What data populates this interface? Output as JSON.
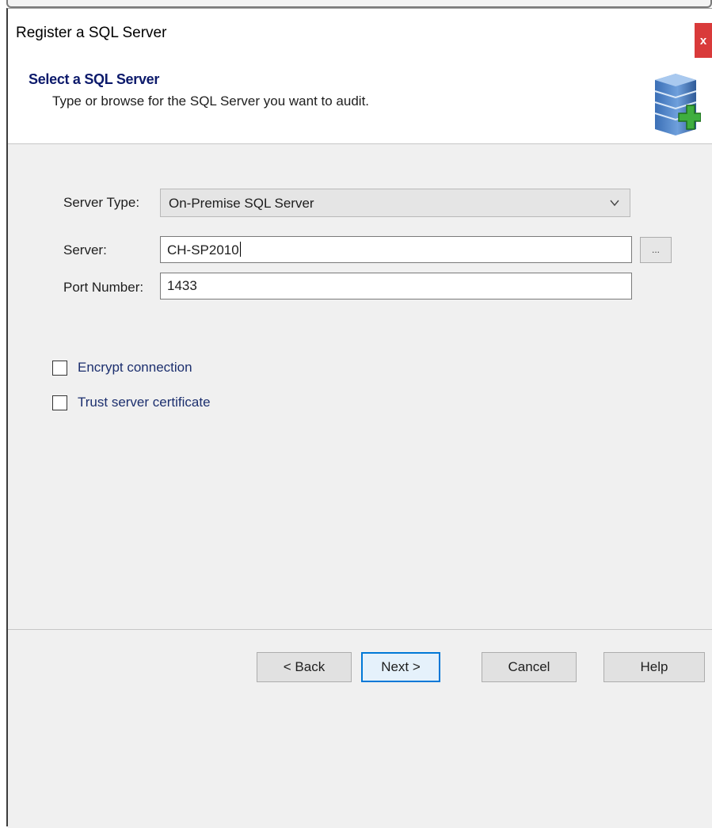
{
  "window": {
    "title": "Register a SQL Server",
    "close_label": "x"
  },
  "header": {
    "title": "Select a SQL Server",
    "subtitle": "Type or browse for the SQL Server you want to audit.",
    "icon": "database-server-add-icon"
  },
  "form": {
    "server_type_label": "Server Type:",
    "server_type_value": "On-Premise SQL Server",
    "server_label": "Server:",
    "server_value": "CH-SP2010",
    "browse_label": "...",
    "port_label": "Port Number:",
    "port_value": "1433",
    "encrypt_label": "Encrypt connection",
    "encrypt_checked": false,
    "trust_label": "Trust server certificate",
    "trust_checked": false
  },
  "footer": {
    "back_label": "< Back",
    "next_label": "Next >",
    "cancel_label": "Cancel",
    "help_label": "Help"
  },
  "colors": {
    "header_title": "#0c1a6b",
    "close_button": "#d93a3a",
    "checkbox_label": "#1c2f6e",
    "default_button_border": "#0078d7"
  }
}
